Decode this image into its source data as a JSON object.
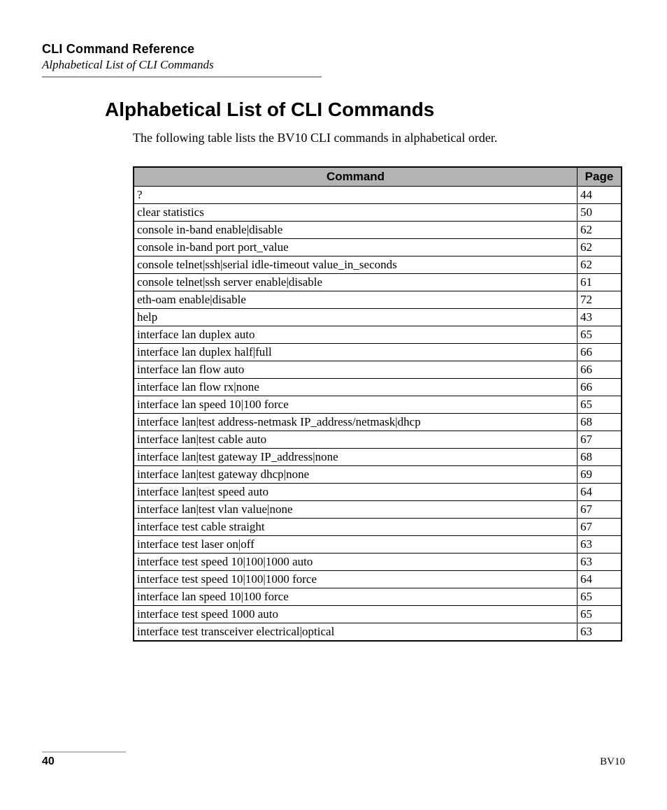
{
  "header": {
    "chapter_title": "CLI Command Reference",
    "section_subtitle": "Alphabetical List of CLI Commands"
  },
  "section": {
    "title": "Alphabetical List of CLI Commands",
    "intro": "The following table lists the BV10 CLI commands in alphabetical order."
  },
  "table": {
    "headers": {
      "command": "Command",
      "page": "Page"
    },
    "rows": [
      {
        "command": "?",
        "page": "44"
      },
      {
        "command": "clear statistics",
        "page": "50"
      },
      {
        "command": "console in-band enable|disable",
        "page": "62"
      },
      {
        "command": "console in-band port port_value",
        "page": "62"
      },
      {
        "command": "console telnet|ssh|serial idle-timeout value_in_seconds",
        "page": "62"
      },
      {
        "command": "console telnet|ssh server enable|disable",
        "page": "61"
      },
      {
        "command": "eth-oam enable|disable",
        "page": "72"
      },
      {
        "command": "help",
        "page": "43"
      },
      {
        "command": "interface lan duplex auto",
        "page": "65"
      },
      {
        "command": "interface lan duplex half|full",
        "page": "66"
      },
      {
        "command": "interface lan flow auto",
        "page": "66"
      },
      {
        "command": "interface lan flow rx|none",
        "page": "66"
      },
      {
        "command": "interface lan speed 10|100 force",
        "page": "65"
      },
      {
        "command": "interface lan|test address-netmask IP_address/netmask|dhcp",
        "page": "68"
      },
      {
        "command": "interface lan|test cable auto",
        "page": "67"
      },
      {
        "command": "interface lan|test gateway IP_address|none",
        "page": "68"
      },
      {
        "command": "interface lan|test gateway dhcp|none",
        "page": "69"
      },
      {
        "command": "interface lan|test speed auto",
        "page": "64"
      },
      {
        "command": "interface lan|test vlan value|none",
        "page": "67"
      },
      {
        "command": "interface test cable straight",
        "page": "67"
      },
      {
        "command": "interface test laser on|off",
        "page": "63"
      },
      {
        "command": "interface test speed 10|100|1000 auto",
        "page": "63"
      },
      {
        "command": "interface test speed 10|100|1000 force",
        "page": "64"
      },
      {
        "command": "interface lan speed 10|100 force",
        "page": "65"
      },
      {
        "command": "interface test speed 1000 auto",
        "page": "65"
      },
      {
        "command": "interface test transceiver electrical|optical",
        "page": "63"
      }
    ]
  },
  "footer": {
    "page_number": "40",
    "doc_id": "BV10"
  }
}
